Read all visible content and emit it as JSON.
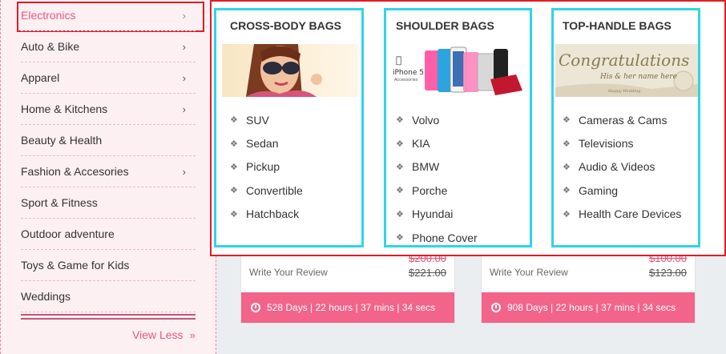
{
  "sidebar": {
    "categories": [
      {
        "label": "Electronics",
        "has_submenu": true,
        "active": true
      },
      {
        "label": "Auto & Bike",
        "has_submenu": true
      },
      {
        "label": "Apparel",
        "has_submenu": true
      },
      {
        "label": "Home & Kitchens",
        "has_submenu": true
      },
      {
        "label": "Beauty & Health",
        "has_submenu": false
      },
      {
        "label": "Fashion & Accesories",
        "has_submenu": true
      },
      {
        "label": "Sport & Fitness",
        "has_submenu": false
      },
      {
        "label": "Outdoor adventure",
        "has_submenu": false
      },
      {
        "label": "Toys & Game for Kids",
        "has_submenu": false
      },
      {
        "label": "Weddings",
        "has_submenu": false
      }
    ],
    "view_less_label": "View Less",
    "view_less_icon": "»",
    "chevron_icon": "›"
  },
  "mega_menu": {
    "columns": [
      {
        "title": "CROSS-BODY BAGS",
        "image": "woman-with-sunglasses-photo",
        "items": [
          "SUV",
          "Sedan",
          "Pickup",
          "Convertible",
          "Hatchback"
        ]
      },
      {
        "title": "SHOULDER BAGS",
        "image": "iphone-5-accessories-photo",
        "image_text": "iPhone 5 Accessories",
        "items": [
          "Volvo",
          "KIA",
          "BMW",
          "Porche",
          "Hyundai",
          "Phone Cover"
        ]
      },
      {
        "title": "TOP-HANDLE BAGS",
        "image": "congratulations-card-photo",
        "image_text": {
          "headline": "Congratulations",
          "sub": "His & her name here",
          "foot": "Happy Wedding"
        },
        "items": [
          "Cameras & Cams",
          "Televisions",
          "Audio & Videos",
          "Gaming",
          "Health Care Devices"
        ]
      }
    ],
    "bullet_icon": "❖"
  },
  "product_cards": [
    {
      "review_label": "Write Your Review",
      "old_price": "$221.00",
      "countdown": "528 Days | 22 hours | 37 mins | 34 secs"
    },
    {
      "review_label": "Write Your Review",
      "old_price": "$123.00",
      "countdown": "908 Days | 22 hours | 37 mins | 34 secs"
    }
  ],
  "colors": {
    "accent_pink": "#e8577c",
    "countdown_bar": "#f26489",
    "highlight_red": "#e21b24",
    "column_outline": "#31d3ea",
    "sidebar_bg": "#fdf0f3"
  }
}
